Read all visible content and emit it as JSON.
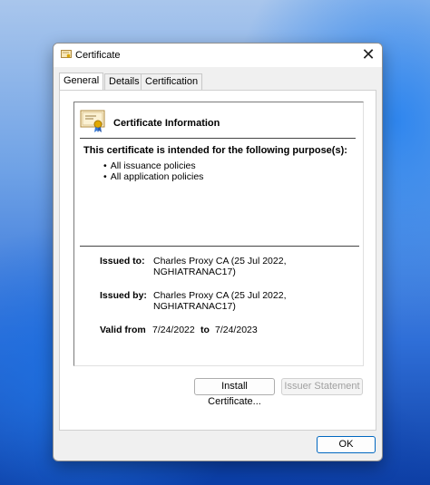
{
  "window": {
    "title": "Certificate",
    "close_glyph": "✕"
  },
  "tabs": [
    {
      "label": "General",
      "active": true
    },
    {
      "label": "Details",
      "active": false
    },
    {
      "label": "Certification Path",
      "active": false
    }
  ],
  "cert": {
    "info_title": "Certificate Information",
    "purpose_heading": "This certificate is intended for the following purpose(s):",
    "purposes": [
      "All issuance policies",
      "All application policies"
    ],
    "issued_to_label": "Issued to:",
    "issued_to_line1": "Charles Proxy CA (25 Jul 2022,",
    "issued_to_line2": "NGHIATRANAC17)",
    "issued_by_label": "Issued by:",
    "issued_by_line1": "Charles Proxy CA (25 Jul 2022,",
    "issued_by_line2": "NGHIATRANAC17)",
    "valid_from_label": "Valid from",
    "valid_from": "7/24/2022",
    "valid_to_label": "to",
    "valid_to": "7/24/2023"
  },
  "buttons": {
    "install": "Install Certificate...",
    "issuer_statement": "Issuer Statement",
    "ok": "OK"
  },
  "icons": {
    "title": "certificate-icon",
    "cert": "certificate-ribbon-icon",
    "close": "close-icon"
  },
  "colors": {
    "accent": "#0067c0",
    "window_bg": "#f0f0f0"
  }
}
